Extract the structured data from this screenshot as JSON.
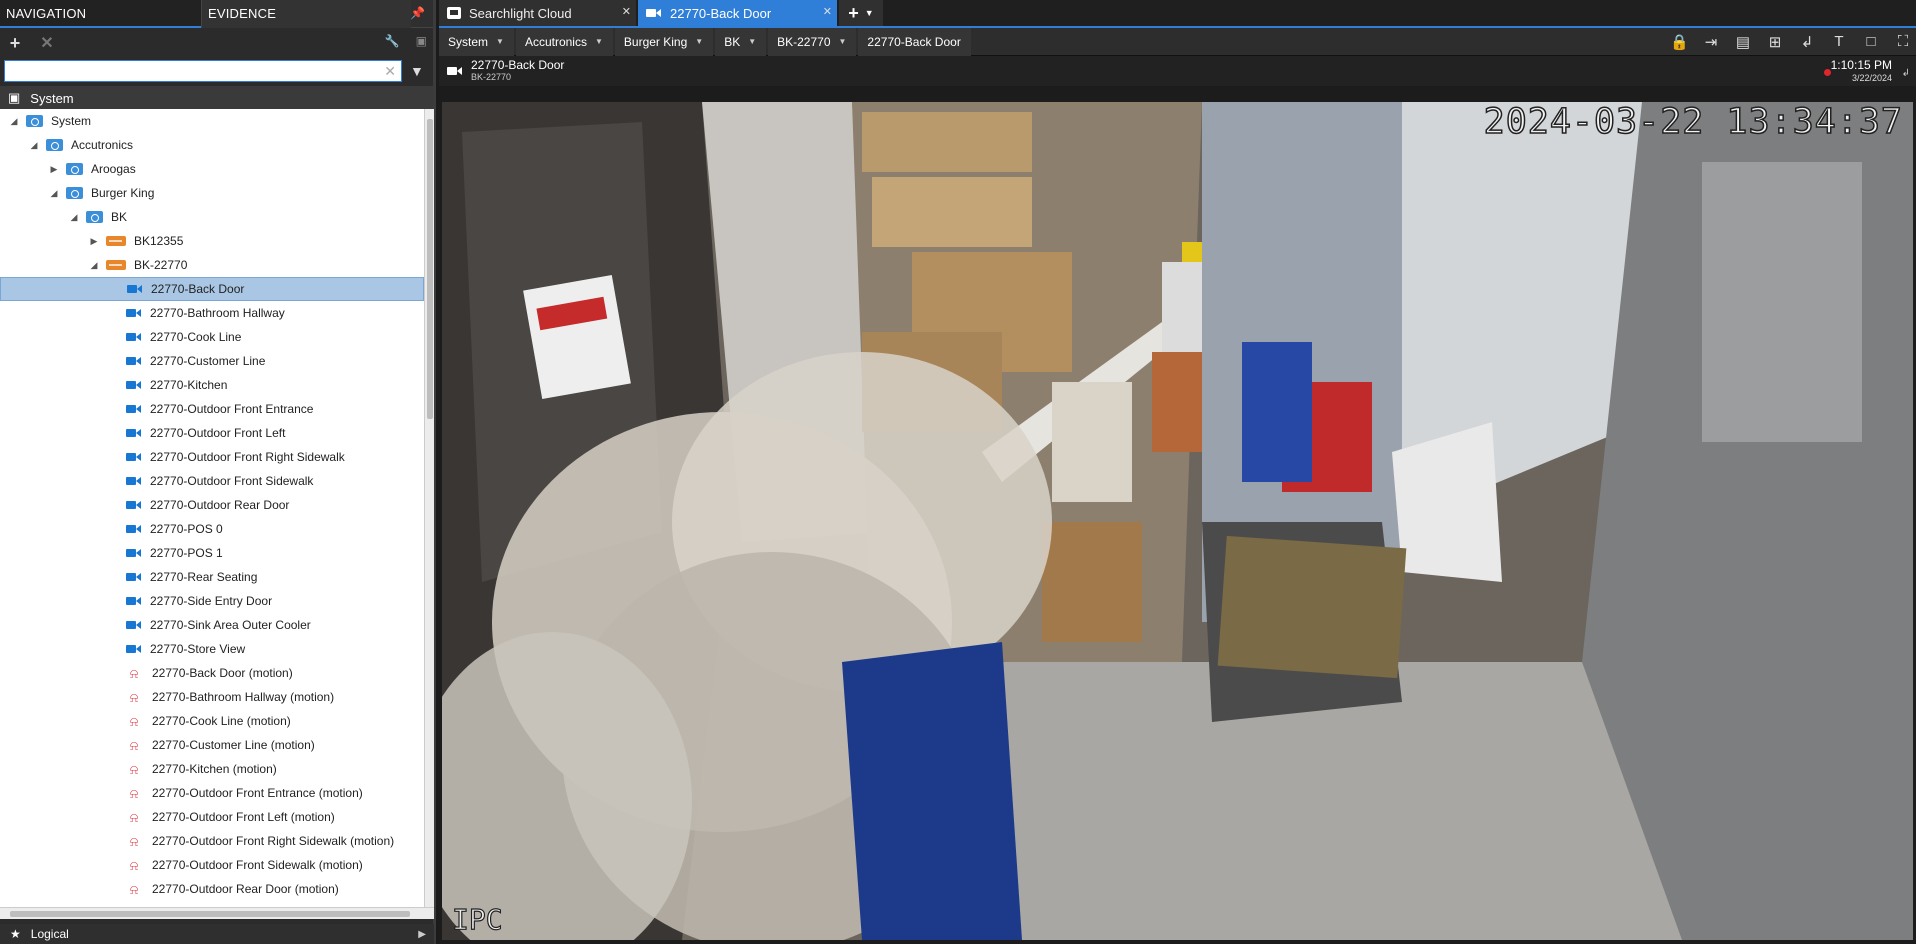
{
  "left_panel": {
    "tabs": [
      "NAVIGATION",
      "EVIDENCE"
    ],
    "search": {
      "value": "",
      "placeholder": ""
    },
    "root_label": "System",
    "tree": [
      {
        "label": "System",
        "depth": 0,
        "icon": "folder",
        "expanded": true
      },
      {
        "label": "Accutronics",
        "depth": 1,
        "icon": "folder",
        "expanded": true
      },
      {
        "label": "Aroogas",
        "depth": 2,
        "icon": "folder",
        "expanded": false
      },
      {
        "label": "Burger King",
        "depth": 2,
        "icon": "folder",
        "expanded": true
      },
      {
        "label": "BK",
        "depth": 3,
        "icon": "folder",
        "expanded": true
      },
      {
        "label": "BK12355",
        "depth": 4,
        "icon": "server",
        "expanded": false
      },
      {
        "label": "BK-22770",
        "depth": 4,
        "icon": "server",
        "expanded": true
      },
      {
        "label": "22770-Back Door",
        "depth": 5,
        "icon": "camera",
        "selected": true
      },
      {
        "label": "22770-Bathroom Hallway",
        "depth": 5,
        "icon": "camera"
      },
      {
        "label": "22770-Cook Line",
        "depth": 5,
        "icon": "camera"
      },
      {
        "label": "22770-Customer Line",
        "depth": 5,
        "icon": "camera"
      },
      {
        "label": "22770-Kitchen",
        "depth": 5,
        "icon": "camera"
      },
      {
        "label": "22770-Outdoor Front Entrance",
        "depth": 5,
        "icon": "camera"
      },
      {
        "label": "22770-Outdoor Front Left",
        "depth": 5,
        "icon": "camera"
      },
      {
        "label": "22770-Outdoor Front Right Sidewalk",
        "depth": 5,
        "icon": "camera"
      },
      {
        "label": "22770-Outdoor Front Sidewalk",
        "depth": 5,
        "icon": "camera"
      },
      {
        "label": "22770-Outdoor Rear Door",
        "depth": 5,
        "icon": "camera"
      },
      {
        "label": "22770-POS 0",
        "depth": 5,
        "icon": "camera"
      },
      {
        "label": "22770-POS 1",
        "depth": 5,
        "icon": "camera"
      },
      {
        "label": "22770-Rear Seating",
        "depth": 5,
        "icon": "camera"
      },
      {
        "label": "22770-Side Entry Door",
        "depth": 5,
        "icon": "camera"
      },
      {
        "label": "22770-Sink Area Outer Cooler",
        "depth": 5,
        "icon": "camera"
      },
      {
        "label": "22770-Store View",
        "depth": 5,
        "icon": "camera"
      },
      {
        "label": "22770-Back Door (motion)",
        "depth": 5,
        "icon": "bell"
      },
      {
        "label": "22770-Bathroom Hallway (motion)",
        "depth": 5,
        "icon": "bell"
      },
      {
        "label": "22770-Cook Line (motion)",
        "depth": 5,
        "icon": "bell"
      },
      {
        "label": "22770-Customer Line (motion)",
        "depth": 5,
        "icon": "bell"
      },
      {
        "label": "22770-Kitchen (motion)",
        "depth": 5,
        "icon": "bell"
      },
      {
        "label": "22770-Outdoor Front Entrance (motion)",
        "depth": 5,
        "icon": "bell"
      },
      {
        "label": "22770-Outdoor Front Left (motion)",
        "depth": 5,
        "icon": "bell"
      },
      {
        "label": "22770-Outdoor Front Right Sidewalk (motion)",
        "depth": 5,
        "icon": "bell"
      },
      {
        "label": "22770-Outdoor Front Sidewalk (motion)",
        "depth": 5,
        "icon": "bell"
      },
      {
        "label": "22770-Outdoor Rear Door (motion)",
        "depth": 5,
        "icon": "bell"
      }
    ],
    "bottom_section": "Logical"
  },
  "tabs": [
    {
      "label": "Searchlight Cloud",
      "icon": "cloud-icon",
      "active": false
    },
    {
      "label": "22770-Back Door",
      "icon": "camera-icon",
      "active": true
    }
  ],
  "breadcrumb": [
    "System",
    "Accutronics",
    "Burger King",
    "BK",
    "BK-22770",
    "22770-Back Door"
  ],
  "tile": {
    "title": "22770-Back Door",
    "subtitle": "BK-22770",
    "time": "1:10:15 PM",
    "date": "3/22/2024"
  },
  "video": {
    "osd_timestamp": "2024-03-22 13:34:37",
    "osd_brand": "IPC"
  },
  "colors": {
    "accent": "#2f7fd8",
    "selection": "#a9c7e4",
    "camera_icon": "#1877d2",
    "server_icon": "#e7862b",
    "alarm_icon": "#d9363e",
    "record_dot": "#e0262b"
  }
}
